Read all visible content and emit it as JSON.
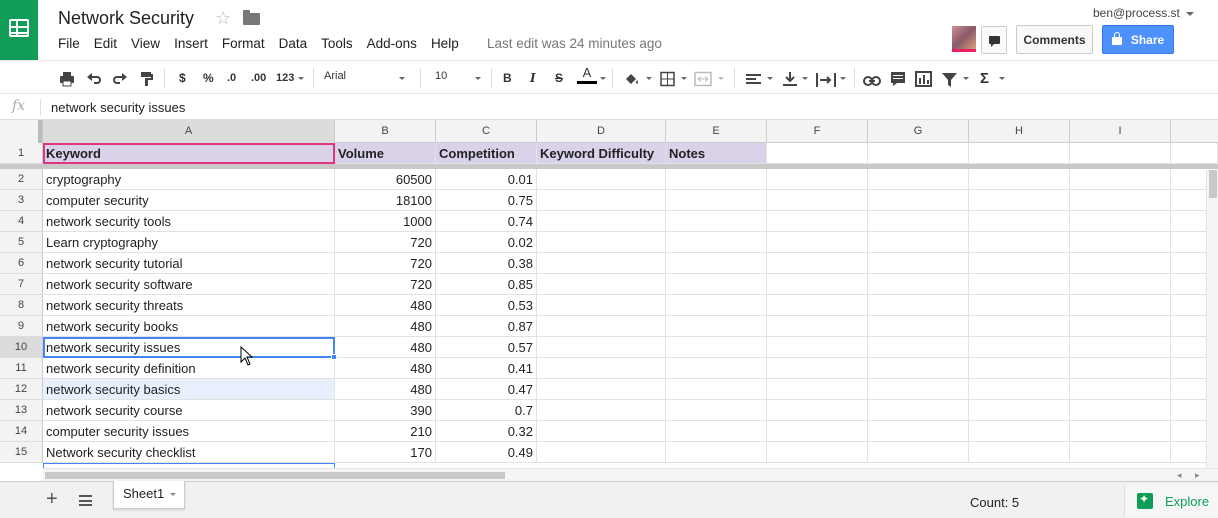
{
  "header": {
    "title": "Network Security",
    "last_edit": "Last edit was 24 minutes ago",
    "account": "ben@process.st",
    "comments_label": "Comments",
    "share_label": "Share"
  },
  "menu": [
    "File",
    "Edit",
    "View",
    "Insert",
    "Format",
    "Data",
    "Tools",
    "Add-ons",
    "Help"
  ],
  "toolbar": {
    "currency_label": "$",
    "percent_label": "%",
    "decimal_less_label": ".0",
    "decimal_more_label": ".00",
    "format_label": "123",
    "font": "Arial",
    "font_size": "10",
    "bold_label": "B",
    "italic_label": "I",
    "strike_label": "S",
    "text_color_label": "A",
    "sum_label": "Σ"
  },
  "formula_bar": {
    "fx_label": "fx",
    "value": "network security issues"
  },
  "grid": {
    "columns": [
      "A",
      "B",
      "C",
      "D",
      "E",
      "F",
      "G",
      "H",
      "I"
    ],
    "selected_column": "A",
    "header_row": {
      "row": "1",
      "cells": [
        "Keyword",
        "Volume",
        "Competition",
        "Keyword Difficulty",
        "Notes"
      ]
    },
    "rows": [
      {
        "row": "2",
        "keyword": "cryptography",
        "volume": "60500",
        "competition": "0.01"
      },
      {
        "row": "3",
        "keyword": "computer security",
        "volume": "18100",
        "competition": "0.75"
      },
      {
        "row": "4",
        "keyword": "network security tools",
        "volume": "1000",
        "competition": "0.74"
      },
      {
        "row": "5",
        "keyword": "Learn cryptography",
        "volume": "720",
        "competition": "0.02"
      },
      {
        "row": "6",
        "keyword": "network security tutorial",
        "volume": "720",
        "competition": "0.38"
      },
      {
        "row": "7",
        "keyword": "network security software",
        "volume": "720",
        "competition": "0.85"
      },
      {
        "row": "8",
        "keyword": "network security threats",
        "volume": "480",
        "competition": "0.53"
      },
      {
        "row": "9",
        "keyword": "network security books",
        "volume": "480",
        "competition": "0.87"
      },
      {
        "row": "10",
        "keyword": "network security issues",
        "volume": "480",
        "competition": "0.57"
      },
      {
        "row": "11",
        "keyword": "network security definition",
        "volume": "480",
        "competition": "0.41"
      },
      {
        "row": "12",
        "keyword": "network security basics",
        "volume": "480",
        "competition": "0.47"
      },
      {
        "row": "13",
        "keyword": "network security course",
        "volume": "390",
        "competition": "0.7"
      },
      {
        "row": "14",
        "keyword": "computer security issues",
        "volume": "210",
        "competition": "0.32"
      },
      {
        "row": "15",
        "keyword": "Network security checklist",
        "volume": "170",
        "competition": "0.49"
      }
    ],
    "active_row": "10"
  },
  "bottom": {
    "sheet_tab": "Sheet1",
    "count": "Count: 5",
    "explore_label": "Explore"
  },
  "colors": {
    "brand_green": "#0f9d58",
    "share_blue": "#4d90fe",
    "header_fill": "#d9d2e9",
    "selection_blue": "#4285f4",
    "active_border_pink": "#e0357f"
  }
}
